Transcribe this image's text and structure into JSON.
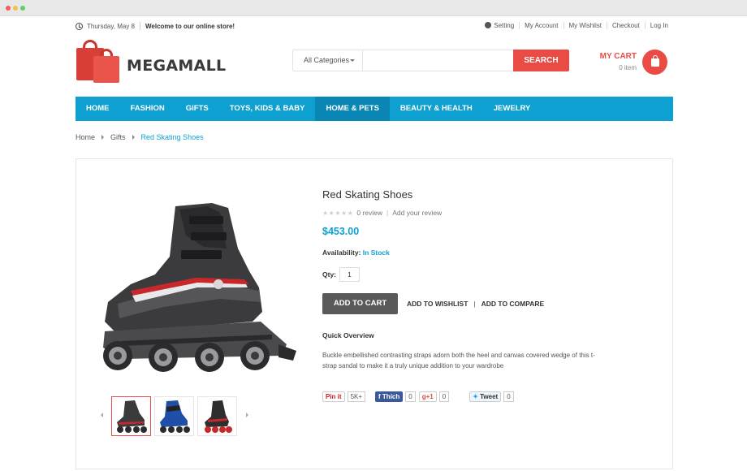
{
  "topbar": {
    "date": "Thursday, May 8",
    "welcome": "Welcome to our online store!",
    "links": [
      "Setting",
      "My Account",
      "My Wishlist",
      "Checkout",
      "Log In"
    ]
  },
  "header": {
    "logo_text": "MEGAMALL",
    "search": {
      "category": "All Categories",
      "placeholder": "",
      "button": "SEARCH"
    },
    "cart": {
      "label": "MY CART",
      "count": "0 item"
    }
  },
  "nav": {
    "items": [
      "HOME",
      "FASHION",
      "GIFTS",
      "TOYS, KIDS & BABY",
      "HOME & PETS",
      "BEAUTY & HEALTH",
      "JEWELRY"
    ],
    "active_index": 4
  },
  "breadcrumb": [
    "Home",
    "Gifts",
    "Red Skating Shoes"
  ],
  "product": {
    "title": "Red Skating Shoes",
    "rating_stars": "★★★★★",
    "reviews": "0 review",
    "add_review": "Add your review",
    "price": "$453.00",
    "availability_label": "Availability:",
    "availability_value": "In Stock",
    "qty_label": "Qty:",
    "qty_value": "1",
    "add_to_cart": "ADD TO CART",
    "add_to_wishlist": "ADD TO WISHLIST",
    "add_to_compare": "ADD TO COMPARE",
    "overview_title": "Quick Overview",
    "description": "Buckle embellished contrasting straps adorn both the heel and canvas covered wedge of this t-strap sandal to make it a truly unique addition to your wardrobe"
  },
  "share": {
    "pinterest": "Pin it",
    "pinterest_count": "5K+",
    "facebook": "Thích",
    "facebook_count": "0",
    "gplus": "g+1",
    "gplus_count": "0",
    "twitter": "Tweet",
    "twitter_count": "0"
  },
  "colors": {
    "accent": "#0fa0d2",
    "brand_red": "#e94b45",
    "nav_active": "#0a86b4"
  }
}
